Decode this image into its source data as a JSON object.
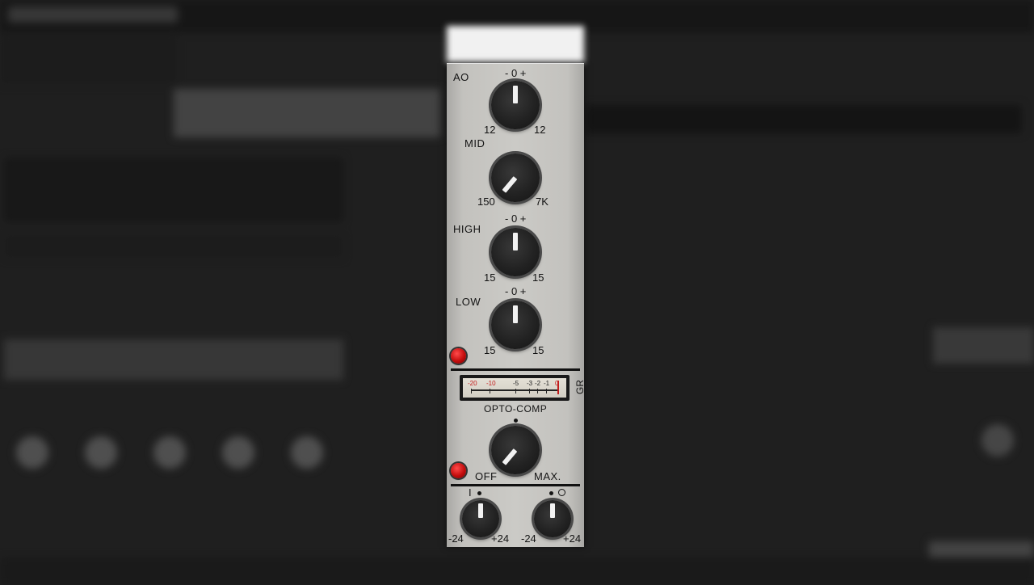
{
  "plugin": {
    "sections": {
      "ao": {
        "label": "AO",
        "scale_top": "- 0 +",
        "scale_left": "12",
        "scale_right": "12"
      },
      "mid": {
        "label": "MID",
        "scale_left": "150",
        "scale_right": "7K"
      },
      "high": {
        "label": "HIGH",
        "scale_top": "- 0 +",
        "scale_left": "15",
        "scale_right": "15"
      },
      "low": {
        "label": "LOW",
        "scale_top": "- 0 +",
        "scale_left": "15",
        "scale_right": "15"
      }
    },
    "meter": {
      "label": "GR",
      "ticks": [
        "-20",
        "-10",
        "-5",
        "-3",
        "-2",
        "-1",
        "0"
      ]
    },
    "comp": {
      "title": "OPTO-COMP",
      "off_label": "OFF",
      "max_label": "MAX."
    },
    "io": {
      "input": {
        "symbol": "I",
        "scale_left": "-24",
        "scale_right": "+24"
      },
      "output": {
        "symbol": "O",
        "scale_left": "-24",
        "scale_right": "+24"
      }
    },
    "colors": {
      "panel": "#c8c7c3",
      "knob": "#222222",
      "led": "#c40d0d",
      "meter_red": "#c21b1b"
    }
  }
}
